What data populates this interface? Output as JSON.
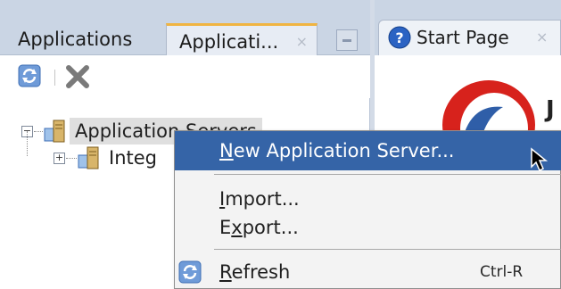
{
  "left_panel": {
    "tabs": [
      {
        "label": "Applications"
      },
      {
        "label": "Applicati...",
        "close": "×"
      }
    ],
    "toolbar": {
      "refresh_icon": "refresh-icon",
      "delete_icon": "delete-x-icon"
    },
    "tree": [
      {
        "label": "Application Servers",
        "expander": "−",
        "icon": "server-icon"
      },
      {
        "label": "Integ",
        "expander": "+",
        "icon": "server-icon"
      }
    ]
  },
  "right_panel": {
    "tab": {
      "label": "Start Page",
      "close": "×",
      "icon": "help-icon"
    },
    "logo_letter": "J"
  },
  "context_menu": {
    "items": [
      {
        "pre": "",
        "mnemonic": "N",
        "post": "ew Application Server...",
        "state": "highlighted"
      },
      {
        "pre": "",
        "mnemonic": "I",
        "post": "mport..."
      },
      {
        "pre": "E",
        "mnemonic": "x",
        "post": "port..."
      },
      {
        "pre": "",
        "mnemonic": "R",
        "post": "efresh",
        "shortcut": "Ctrl-R",
        "icon": "refresh-icon"
      }
    ]
  },
  "colors": {
    "highlight": "#3564a7",
    "tab_accent": "#f0b441",
    "tab_strip": "#cad5e4"
  }
}
